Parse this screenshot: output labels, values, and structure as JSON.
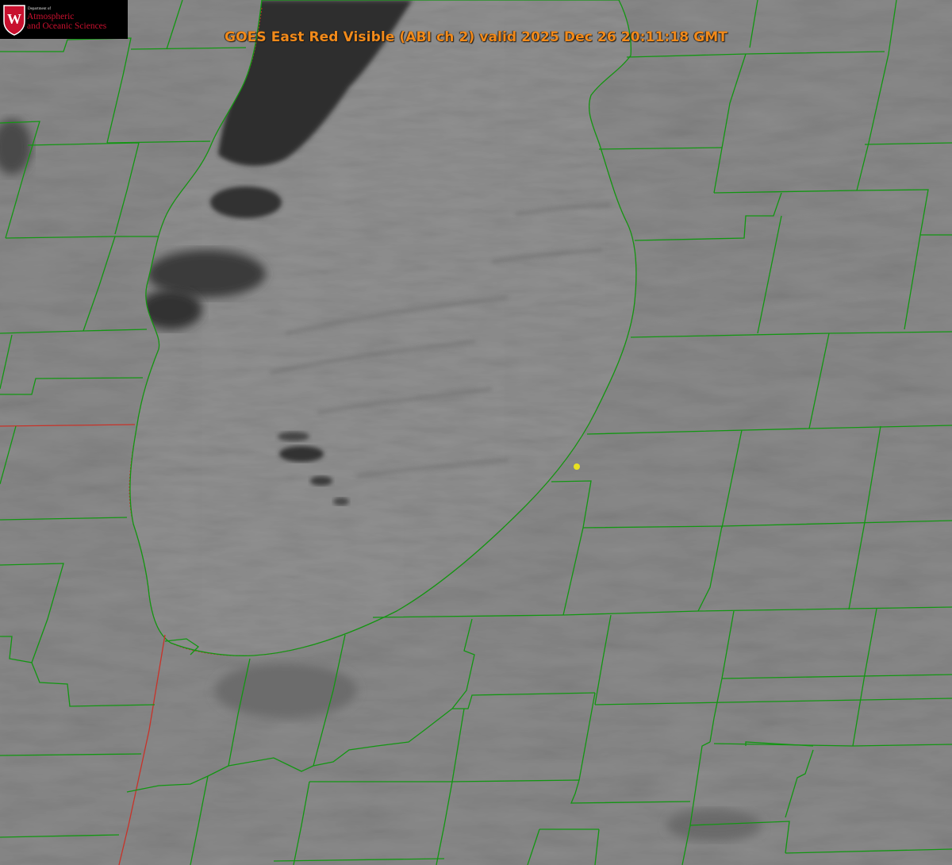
{
  "header": {
    "title": "GOES East Red Visible (ABI ch 2) valid 2025 Dec 26 20:11:18 GMT"
  },
  "logo": {
    "dept_text": "Department of",
    "line1": "Atmospheric",
    "line2": "and Oceanic Sciences",
    "crest_letter": "W"
  },
  "colors": {
    "county_border": "#129612",
    "state_border": "#c83228",
    "shoreline": "#129612",
    "title": "#f28a1a",
    "marker": "#e8e020",
    "logo_red": "#c8102e"
  },
  "map": {
    "imagery": "satellite-visible-cloud-field",
    "feature": "Lake Michigan",
    "marker": "station-location-dot"
  }
}
